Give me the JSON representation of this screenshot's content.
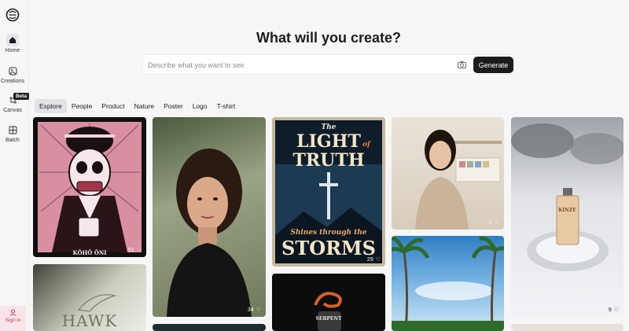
{
  "sidebar": {
    "items": [
      {
        "label": "Home"
      },
      {
        "label": "Creations"
      },
      {
        "label": "Canvas"
      },
      {
        "label": "Batch"
      }
    ],
    "beta_badge": "Beta",
    "signin_label": "Sign in"
  },
  "hero": {
    "title": "What will you create?",
    "placeholder": "Describe what you want to see",
    "generate_label": "Generate"
  },
  "tabs": [
    "Explore",
    "People",
    "Product",
    "Nature",
    "Poster",
    "Logo",
    "T-shirt"
  ],
  "gallery": {
    "cards": [
      {
        "likes": "51",
        "caption": "KŌHŌ ŌNI"
      },
      {
        "likes": "34"
      },
      {
        "likes": "29",
        "title_top": "The",
        "title_main_1": "LIGHT",
        "title_of": "of",
        "title_main_2": "TRUTH",
        "subtitle": "Shines through the",
        "title_bottom": "STORMS"
      },
      {
        "likes": "1"
      },
      {
        "likes": "9",
        "label": "KINZE"
      },
      {
        "caption": "HAWK"
      },
      {
        "caption": "SERPENT"
      }
    ]
  },
  "colors": {
    "accent": "#1c1c1e",
    "signin_bg": "#fbe3ea",
    "signin_text": "#c0405f"
  }
}
